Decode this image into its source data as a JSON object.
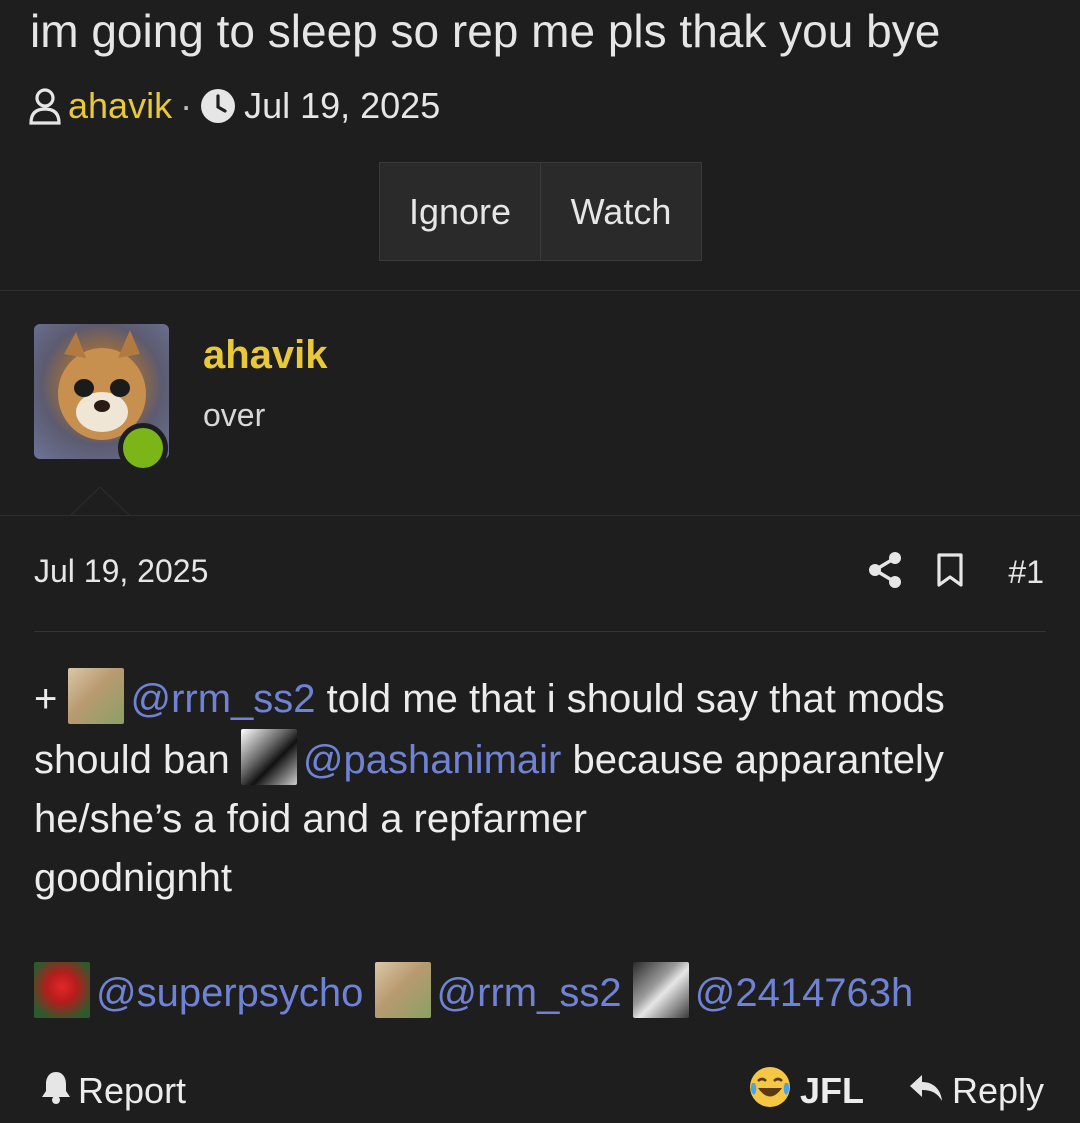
{
  "thread": {
    "title": "im going to sleep so rep me pls thak you bye",
    "author": "ahavik",
    "separator": "·",
    "date": "Jul 19, 2025"
  },
  "actions": {
    "ignore_label": "Ignore",
    "watch_label": "Watch"
  },
  "user": {
    "name": "ahavik",
    "title": "over",
    "online": true
  },
  "post": {
    "date": "Jul 19, 2025",
    "number": "#1",
    "prefix": "+",
    "mention1": "@rrm_ss2",
    "text1": " told me that i should say that mods should ban ",
    "mention2": "@pashanimair",
    "text2": " because apparantely he/she’s a foid and a repfarmer",
    "text3": "goodnignht",
    "mentions": [
      "@superpsycho",
      "@rrm_ss2",
      "@2414763h"
    ]
  },
  "footer": {
    "report_label": "Report",
    "reaction_label": "JFL",
    "reply_label": "Reply"
  },
  "colors": {
    "accent_username": "#e8c93a",
    "mention": "#6f82d4",
    "online": "#7cb518",
    "background": "#1e1e1e"
  },
  "icons": [
    "user-icon",
    "clock-icon",
    "share-icon",
    "bookmark-icon",
    "bell-icon",
    "laughing-emoji-icon",
    "reply-icon"
  ]
}
